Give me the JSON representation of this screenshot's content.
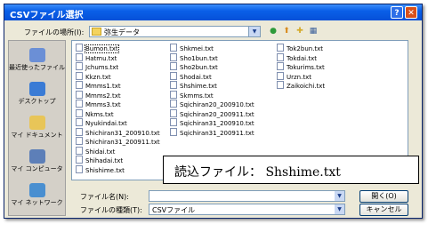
{
  "dialog": {
    "title": "CSVファイル選択",
    "help_label": "?",
    "close_label": "✕",
    "location_label": "ファイルの場所(I):",
    "location_value": "弥生データ",
    "location_arrow": "▼",
    "toolbar_icons": [
      "back-icon",
      "up-folder-icon",
      "new-folder-icon",
      "view-menu-icon"
    ]
  },
  "places": [
    {
      "label": "最近使ったファイル",
      "icon": "recent-files-icon",
      "color": "#6b8fd6"
    },
    {
      "label": "デスクトップ",
      "icon": "desktop-icon",
      "color": "#3a7bd5"
    },
    {
      "label": "マイ ドキュメント",
      "icon": "my-documents-icon",
      "color": "#e8c558"
    },
    {
      "label": "マイ コンピュータ",
      "icon": "my-computer-icon",
      "color": "#5d7fb8"
    },
    {
      "label": "マイ ネットワーク",
      "icon": "my-network-icon",
      "color": "#4a8fd0"
    }
  ],
  "files": {
    "col1": [
      "Bumon.txt",
      "Hatmu.txt",
      "Jchums.txt",
      "Kkzn.txt",
      "Mmms1.txt",
      "Mmms2.txt",
      "Mmms3.txt",
      "Nkms.txt",
      "Nyukindai.txt",
      "Shichiran31_200910.txt",
      "Shichiran31_200911.txt",
      "Shidai.txt",
      "Shihadai.txt",
      "Shishime.txt"
    ],
    "col2": [
      "Shkmei.txt",
      "Sho1bun.txt",
      "Sho2bun.txt",
      "Shodai.txt",
      "Shshime.txt",
      "Skmms.txt",
      "Sqichiran20_200910.txt",
      "Sqichiran20_200911.txt",
      "Sqichiran31_200910.txt",
      "Sqichiran31_200911.txt"
    ],
    "col3": [
      "Tok2bun.txt",
      "Tokdai.txt",
      "Tokurims.txt",
      "Urzn.txt",
      "Zaikoichi.txt"
    ]
  },
  "callout": "読込ファイル： Shshime.txt",
  "filename_label": "ファイル名(N):",
  "filename_value": "",
  "filetype_label": "ファイルの種類(T):",
  "filetype_value": "CSVファイル",
  "dropdown_arrow": "▼",
  "open_label": "開く(O)",
  "cancel_label": "キャンセル"
}
